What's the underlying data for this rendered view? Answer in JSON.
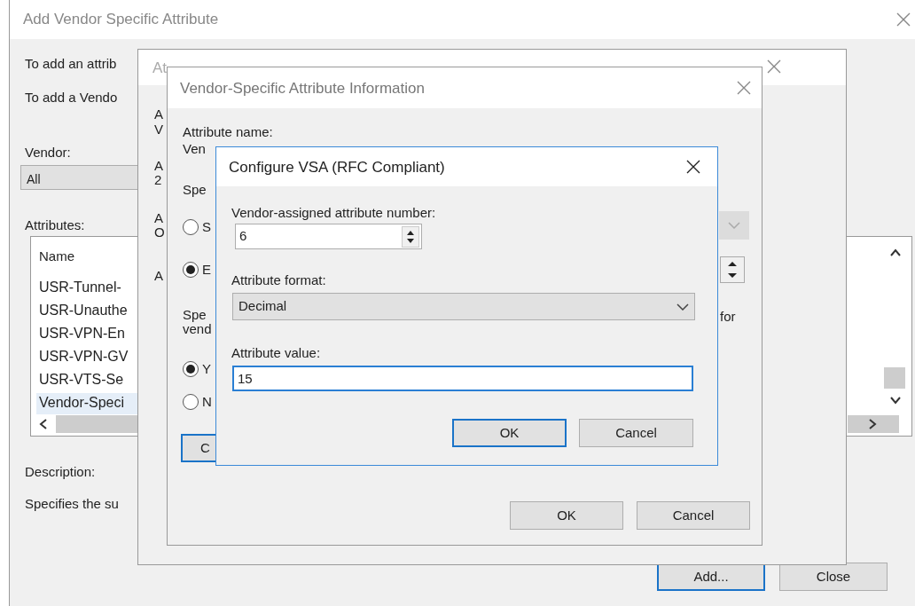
{
  "main_window": {
    "title": "Add Vendor Specific Attribute",
    "intro_lines": [
      "To add an attrib",
      "To add a Vendo"
    ],
    "vendor_label": "Vendor:",
    "vendor_value": "All",
    "attributes_label": "Attributes:",
    "list": {
      "column": "Name",
      "items": [
        {
          "label": "USR-Tunnel-",
          "selected": false
        },
        {
          "label": "USR-Unauthe",
          "selected": false
        },
        {
          "label": "USR-VPN-En",
          "selected": false
        },
        {
          "label": "USR-VPN-GV",
          "selected": false
        },
        {
          "label": "USR-VTS-Se",
          "selected": false
        },
        {
          "label": "Vendor-Speci",
          "selected": true
        }
      ]
    },
    "description_label": "Description:",
    "description": "Specifies the su",
    "buttons": [
      {
        "label": "Add...",
        "default": true
      },
      {
        "label": "Close",
        "default": false
      }
    ]
  },
  "attribute_info_window": {
    "title": "At",
    "left_texts": [
      "A",
      "V",
      "A",
      "2",
      "A",
      "O",
      "A"
    ]
  },
  "vsa_info_window": {
    "title": "Vendor-Specific Attribute Information",
    "attribute_name_label": "Attribute name:",
    "attribute_name_value": "Ven",
    "spec_label": "Spe",
    "format_radios": [
      {
        "label": "S",
        "selected": false
      },
      {
        "label": "E",
        "selected": true
      }
    ],
    "conformance_lines": [
      "Spe",
      "vend"
    ],
    "conformance_trailing": "for",
    "conformance_radios": [
      {
        "label": "Y",
        "selected": true
      },
      {
        "label": "N",
        "selected": false
      }
    ],
    "partial_button": {
      "label": "C",
      "default": true
    },
    "buttons": [
      {
        "label": "OK",
        "default": false
      },
      {
        "label": "Cancel",
        "default": false
      }
    ]
  },
  "configure_window": {
    "title": "Configure VSA (RFC Compliant)",
    "number_label": "Vendor-assigned attribute number:",
    "number_value": "6",
    "format_label": "Attribute format:",
    "format_value": "Decimal",
    "value_label": "Attribute value:",
    "value": "15",
    "buttons": [
      {
        "label": "OK",
        "default": true
      },
      {
        "label": "Cancel",
        "default": false
      }
    ]
  }
}
